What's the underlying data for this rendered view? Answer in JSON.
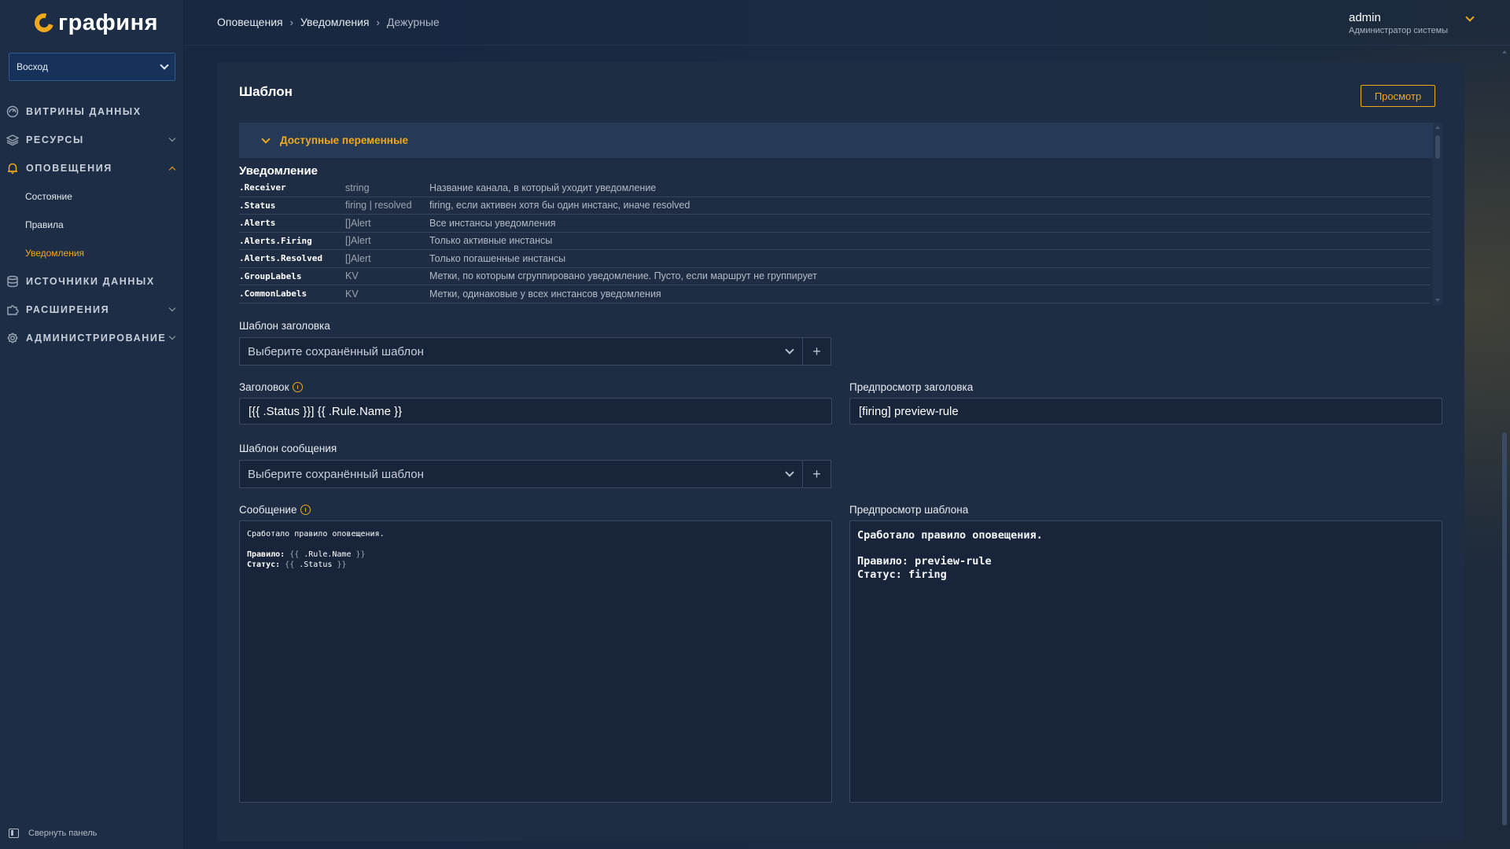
{
  "app": {
    "logo_text": "графиня",
    "accent": "#f0a81d"
  },
  "sidebar": {
    "org": "Восход",
    "items": [
      {
        "label": "Витрины данных",
        "icon": "dashboard-icon",
        "expandable": false
      },
      {
        "label": "Ресурсы",
        "icon": "layers-icon",
        "expandable": true
      },
      {
        "label": "Оповещения",
        "icon": "bell-icon",
        "expandable": true,
        "expanded": true
      },
      {
        "label": "Источники данных",
        "icon": "database-icon",
        "expandable": false
      },
      {
        "label": "Расширения",
        "icon": "puzzle-icon",
        "expandable": true
      },
      {
        "label": "Администрирование",
        "icon": "gear-icon",
        "expandable": true
      }
    ],
    "alert_subitems": [
      {
        "label": "Состояние"
      },
      {
        "label": "Правила"
      },
      {
        "label": "Уведомления",
        "active": true
      }
    ],
    "collapse_label": "Свернуть панель"
  },
  "breadcrumb": [
    "Оповещения",
    "Уведомления",
    "Дежурные"
  ],
  "user": {
    "name": "admin",
    "role": "Администратор системы"
  },
  "template": {
    "title": "Шаблон",
    "preview_button": "Просмотр",
    "vars_header": "Доступные переменные",
    "vars_section": "Уведомление",
    "variables": [
      {
        "name": ".Receiver",
        "type": "string",
        "desc": "Название канала, в который уходит уведомление"
      },
      {
        "name": ".Status",
        "type": "firing | resolved",
        "desc": "firing, если активен хотя бы один инстанс, иначе resolved"
      },
      {
        "name": ".Alerts",
        "type": "[]Alert",
        "desc": "Все инстансы уведомления"
      },
      {
        "name": ".Alerts.Firing",
        "type": "[]Alert",
        "desc": "Только активные инстансы"
      },
      {
        "name": ".Alerts.Resolved",
        "type": "[]Alert",
        "desc": "Только погашенные инстансы"
      },
      {
        "name": ".GroupLabels",
        "type": "KV",
        "desc": "Метки, по которым сгруппировано уведомление. Пусто, если маршрут не группирует"
      },
      {
        "name": ".CommonLabels",
        "type": "KV",
        "desc": "Метки, одинаковые у всех инстансов уведомления"
      }
    ],
    "header_template_label": "Шаблон заголовка",
    "header_template_placeholder": "Выберите сохранённый шаблон",
    "subject_label": "Заголовок",
    "subject_value": "[{{ .Status }}] {{ .Rule.Name }}",
    "subject_preview_label": "Предпросмотр заголовка",
    "subject_preview_value": "[firing] preview-rule",
    "message_template_label": "Шаблон сообщения",
    "message_template_placeholder": "Выберите сохранённый шаблон",
    "message_label": "Сообщение",
    "message_line1": "Сработало правило оповещения.",
    "message_rule_prefix": "Правило: ",
    "message_rule_var": ".Rule.Name",
    "message_status_prefix": "Статус: ",
    "message_status_var": ".Status",
    "tmpl_open": "{{",
    "tmpl_close": "}}",
    "message_preview_label": "Предпросмотр шаблона",
    "message_preview_line1": "Сработало правило оповещения.",
    "message_preview_line2": "Правило: preview-rule",
    "message_preview_line3": "Статус: firing",
    "plus_symbol": "+"
  }
}
